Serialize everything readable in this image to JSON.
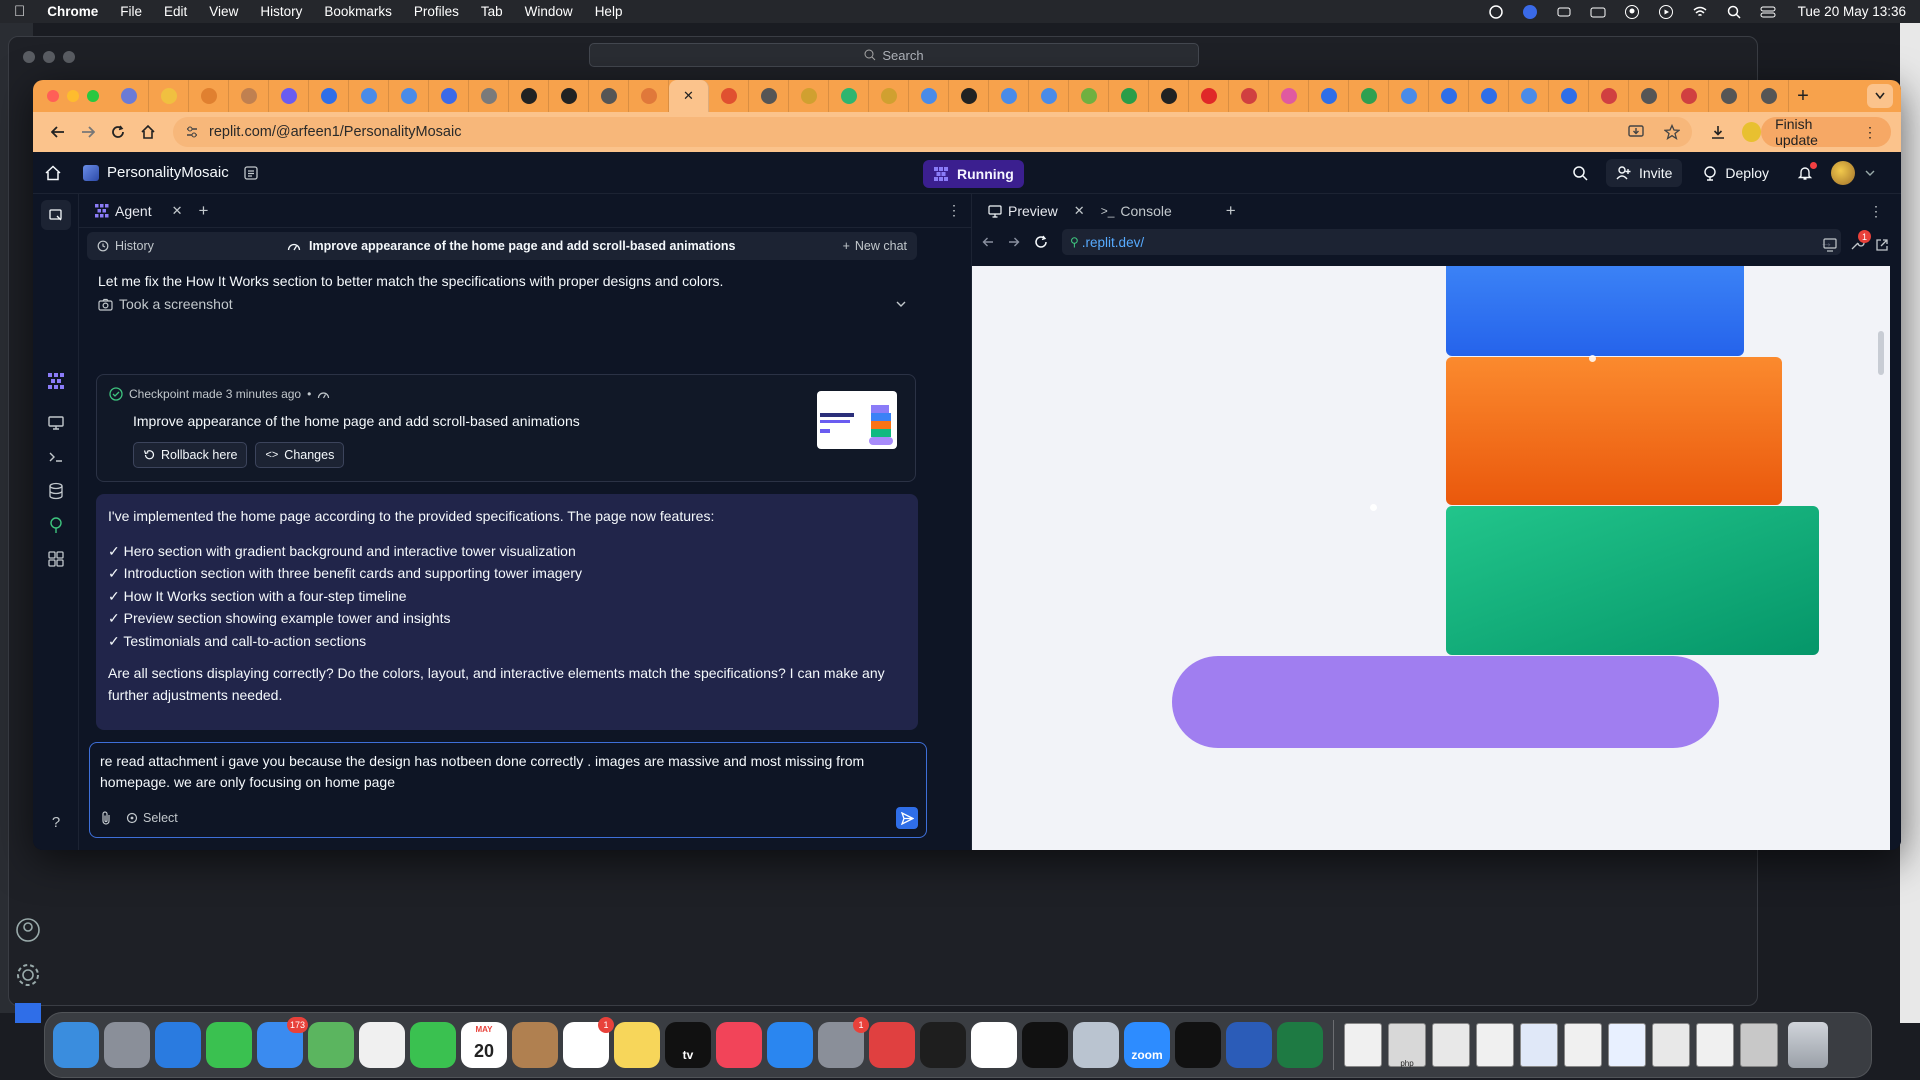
{
  "menubar": {
    "apple": "",
    "items": [
      "Chrome",
      "File",
      "Edit",
      "View",
      "History",
      "Bookmarks",
      "Profiles",
      "Tab",
      "Window",
      "Help"
    ],
    "clock": "Tue 20 May  13:36"
  },
  "back_window": {
    "search": "Search"
  },
  "browser": {
    "url": "replit.com/@arfeen1/PersonalityMosaic",
    "finish_update": "Finish update",
    "tab_colors": [
      "#6b7bd6",
      "#f0c040",
      "#e08030",
      "#c08050",
      "#6a5cf0",
      "#2f6ee8",
      "#4a8be8",
      "#4a8be8",
      "#3b6ae8",
      "#7a7a7a",
      "#222",
      "#222",
      "#555",
      "#e0783a",
      "#ffffff",
      "#e05030",
      "#555",
      "#d0a030",
      "#2fb56f",
      "#d0a030",
      "#4a8be8",
      "#222",
      "#4a8be8",
      "#4a8be8",
      "#70b040",
      "#2a9d48",
      "#222",
      "#e02828",
      "#d04040",
      "#e05aa0",
      "#2f6ee8",
      "#2fa050",
      "#4a8be8",
      "#2f6ee8",
      "#2f6ee8",
      "#4a8be8",
      "#2f6ee8",
      "#d04040",
      "#555",
      "#d04040",
      "#555",
      "#555"
    ]
  },
  "replit": {
    "project_name": "PersonalityMosaic",
    "run_status": "Running",
    "invite": "Invite",
    "deploy": "Deploy",
    "agent_tab": "Agent",
    "history": "History",
    "chat_title": "Improve appearance of the home page and add scroll-based animations",
    "new_chat": "New chat",
    "msg1": "Let me fix the How It Works section to better match the specifications with proper designs and colors.",
    "screenshot_label": "Took a screenshot",
    "checkpoint": {
      "meta": "Checkpoint made 3 minutes ago",
      "title": "Improve appearance of the home page and add scroll-based animations",
      "rollback": "Rollback here",
      "changes": "Changes"
    },
    "ai_message": {
      "intro": "I've implemented the home page according to the provided specifications. The page now features:",
      "bullets": [
        "✓ Hero section with gradient background and interactive tower visualization",
        "✓ Introduction section with three benefit cards and supporting tower imagery",
        "✓ How It Works section with a four-step timeline",
        "✓ Preview section showing example tower and insights",
        "✓ Testimonials and call-to-action sections"
      ],
      "question": "Are all sections displaying correctly? Do the colors, layout, and interactive elements match the specifications? I can make any further adjustments needed."
    },
    "input_value": "re read attachment i gave you because the design has notbeen done correctly . images are massive and most missing from homepage. we are only focusing on home page",
    "select_label": "Select",
    "preview_tab": "Preview",
    "console_tab": "Console",
    "preview_url": ".replit.dev/",
    "notif_count": "1"
  },
  "dock": {
    "apps": [
      {
        "name": "finder",
        "color": "#3a8dde"
      },
      {
        "name": "launchpad",
        "color": "#8a8f99"
      },
      {
        "name": "safari",
        "color": "#2a7be0"
      },
      {
        "name": "messages",
        "color": "#3ac150"
      },
      {
        "name": "mail",
        "color": "#3a8bf0",
        "badge": "173"
      },
      {
        "name": "maps",
        "color": "#5bb55f"
      },
      {
        "name": "photos",
        "color": "#f0f0f0"
      },
      {
        "name": "facetime",
        "color": "#3ac150"
      },
      {
        "name": "calendar",
        "color": "#ffffff",
        "label": "20",
        "month": "MAY"
      },
      {
        "name": "contacts",
        "color": "#b08050"
      },
      {
        "name": "reminders",
        "color": "#ffffff",
        "badge": "1"
      },
      {
        "name": "notes",
        "color": "#f7d65a"
      },
      {
        "name": "appletv",
        "color": "#111111",
        "label": "tv"
      },
      {
        "name": "music",
        "color": "#f24459"
      },
      {
        "name": "appstore",
        "color": "#2a86f0"
      },
      {
        "name": "settings",
        "color": "#8a8f99",
        "badge": "1"
      },
      {
        "name": "bookmarks-app",
        "color": "#e04040"
      },
      {
        "name": "vscode",
        "color": "#1e1e1e"
      },
      {
        "name": "chrome",
        "color": "#ffffff"
      },
      {
        "name": "terminal",
        "color": "#111111"
      },
      {
        "name": "utility",
        "color": "#bac4d0"
      },
      {
        "name": "zoom",
        "color": "#2d8cff",
        "label": "zoom"
      },
      {
        "name": "chatgpt",
        "color": "#111111"
      },
      {
        "name": "word",
        "color": "#2b5cb8"
      },
      {
        "name": "excel",
        "color": "#1e7a43"
      }
    ],
    "docs": [
      "#f0f0f0",
      "#d8d8d8",
      "#e8e8e8",
      "#f0f0f0",
      "#e0e8f8",
      "#f0f0f0",
      "#e8f0ff",
      "#e8e8e8",
      "#f0f0f0",
      "#c8c8c8"
    ],
    "doc_caption": "php"
  }
}
